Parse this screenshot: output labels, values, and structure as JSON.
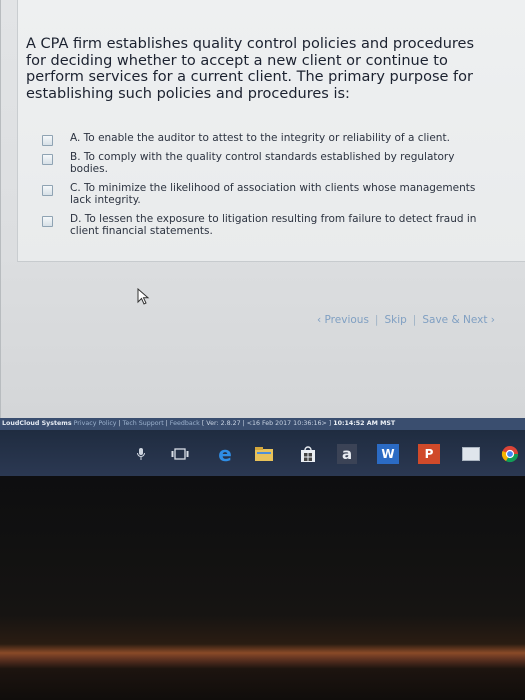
{
  "question": {
    "text": "A CPA firm establishes quality control policies and procedures for deciding whether to accept a new client or continue to perform services for a current client. The primary purpose for establishing such policies and procedures is:"
  },
  "options": [
    {
      "label": "A. To enable the auditor to attest to the integrity or reliability of a client."
    },
    {
      "label": "B. To comply with the quality control standards established by regulatory bodies."
    },
    {
      "label": "C. To minimize the likelihood of association with clients whose managements lack integrity."
    },
    {
      "label": "D. To lessen the exposure to litigation resulting from failure to detect fraud in client financial statements."
    }
  ],
  "nav": {
    "previous": "‹ Previous",
    "skip": "Skip",
    "save_next": "Save & Next ›"
  },
  "status_bar": {
    "brand": "LoudCloud Systems",
    "privacy": "Privacy Policy",
    "support": "Tech Support",
    "feedback": "Feedback",
    "version": "[ Ver: 2.8.27 | <16 Feb 2017 10:36:16> ]",
    "time": "10:14:52 AM MST"
  },
  "taskbar": {
    "icons": [
      "microphone-icon",
      "task-view-icon",
      "edge-icon",
      "file-explorer-icon",
      "store-icon",
      "amazon-icon",
      "word-icon",
      "powerpoint-icon",
      "tablet-icon",
      "chrome-icon"
    ],
    "amazon_glyph": "a",
    "word_glyph": "W",
    "ppt_glyph": "P"
  },
  "colors": {
    "status_bar": "#3a4e6f",
    "nav_link": "#7f9fc2",
    "taskbar": "#243248"
  }
}
